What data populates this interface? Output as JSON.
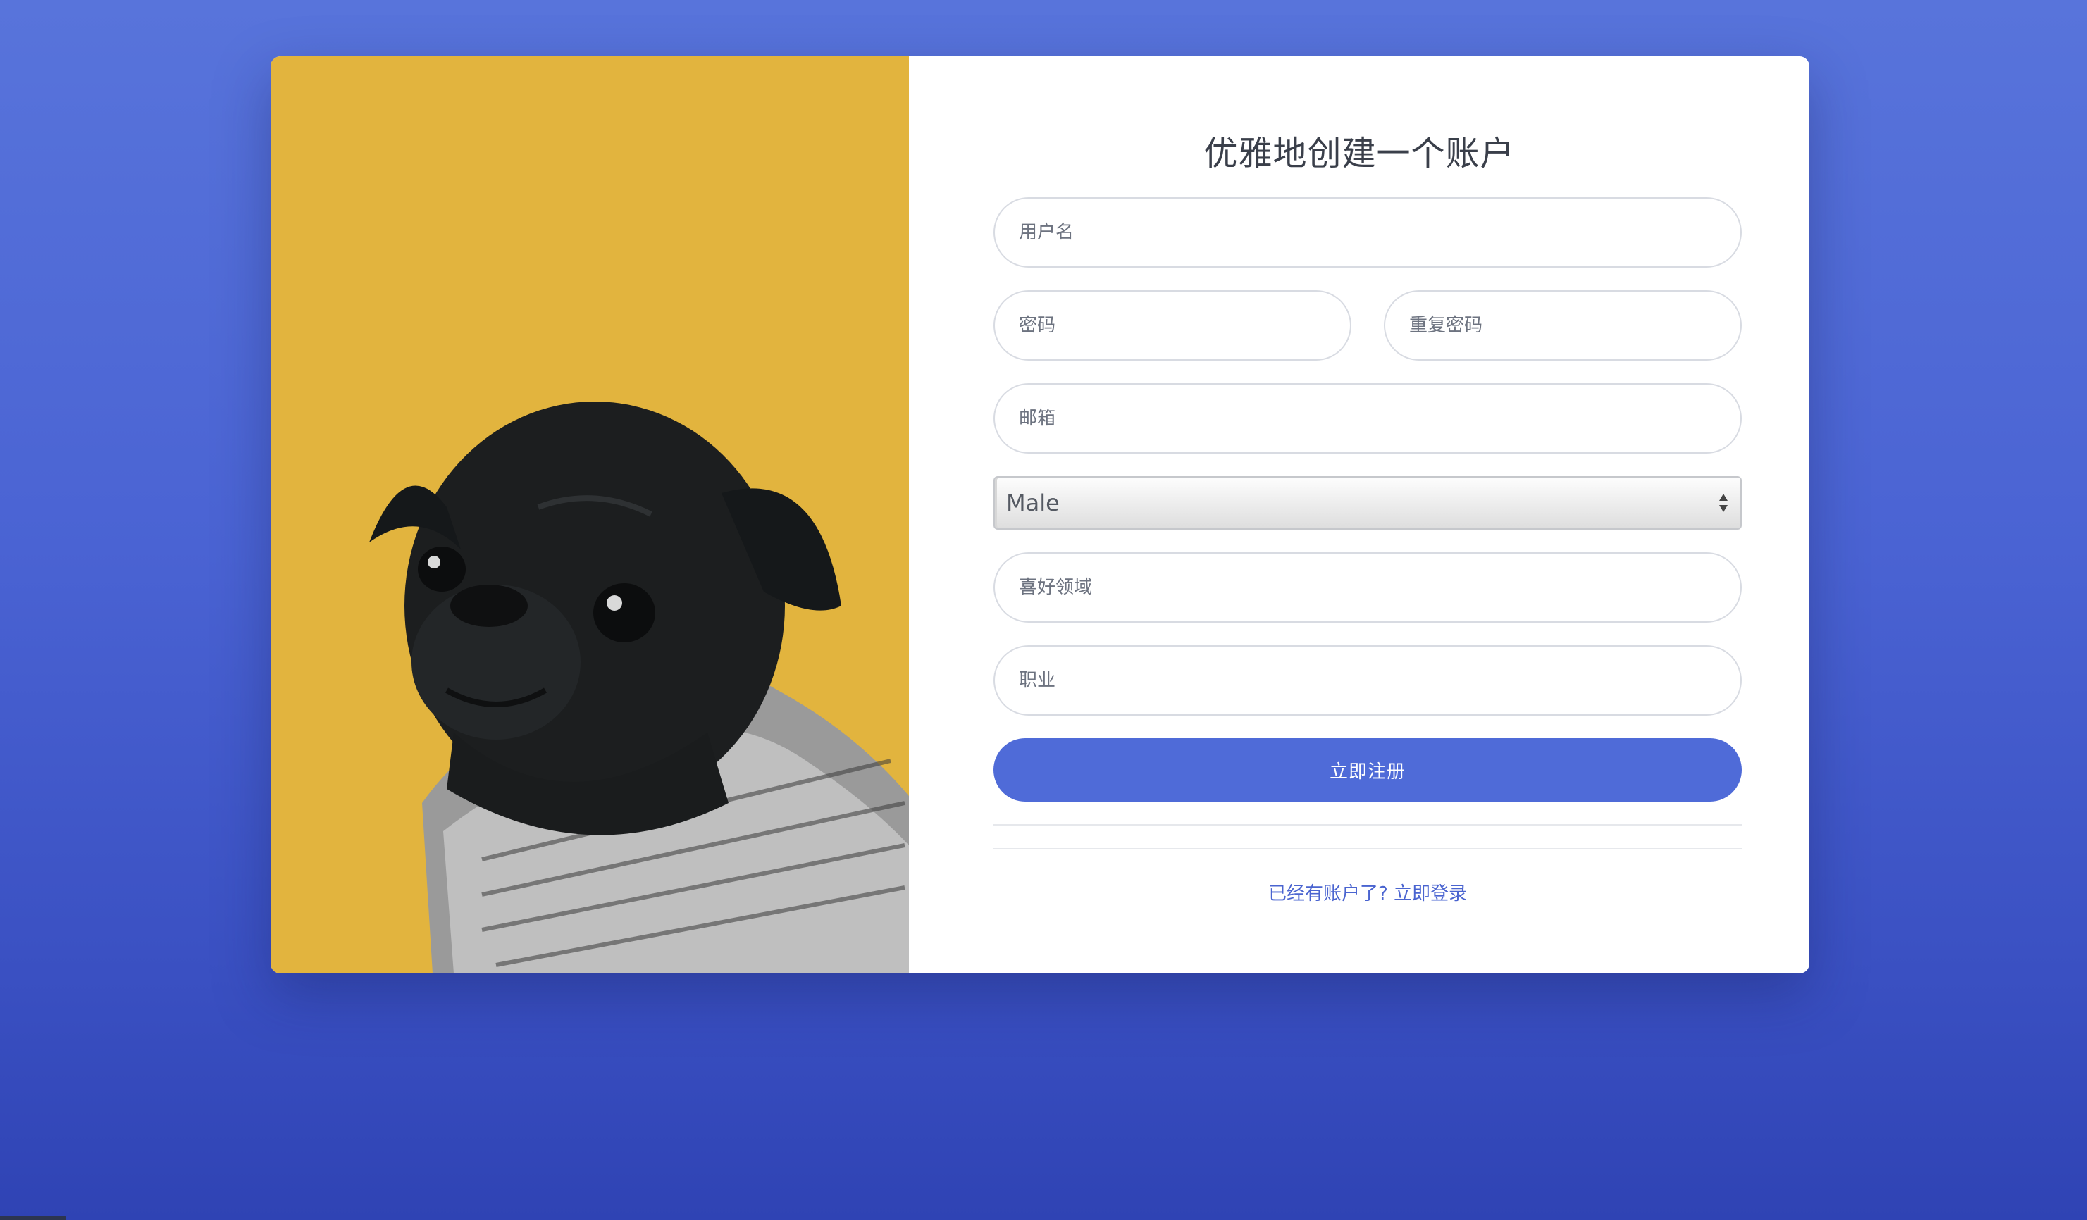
{
  "form": {
    "title": "优雅地创建一个账户",
    "username_placeholder": "用户名",
    "password_placeholder": "密码",
    "repeat_password_placeholder": "重复密码",
    "email_placeholder": "邮箱",
    "gender_selected": "Male",
    "interest_placeholder": "喜好领域",
    "occupation_placeholder": "职业",
    "submit_label": "立即注册",
    "login_link": "已经有账户了? 立即登录"
  },
  "colors": {
    "background": "#4a63d3",
    "photo_background": "#e2b43e",
    "button": "#4f6bd8",
    "link": "#4a64d0"
  },
  "icons": {
    "select_arrow": "up-down-arrows-icon"
  }
}
